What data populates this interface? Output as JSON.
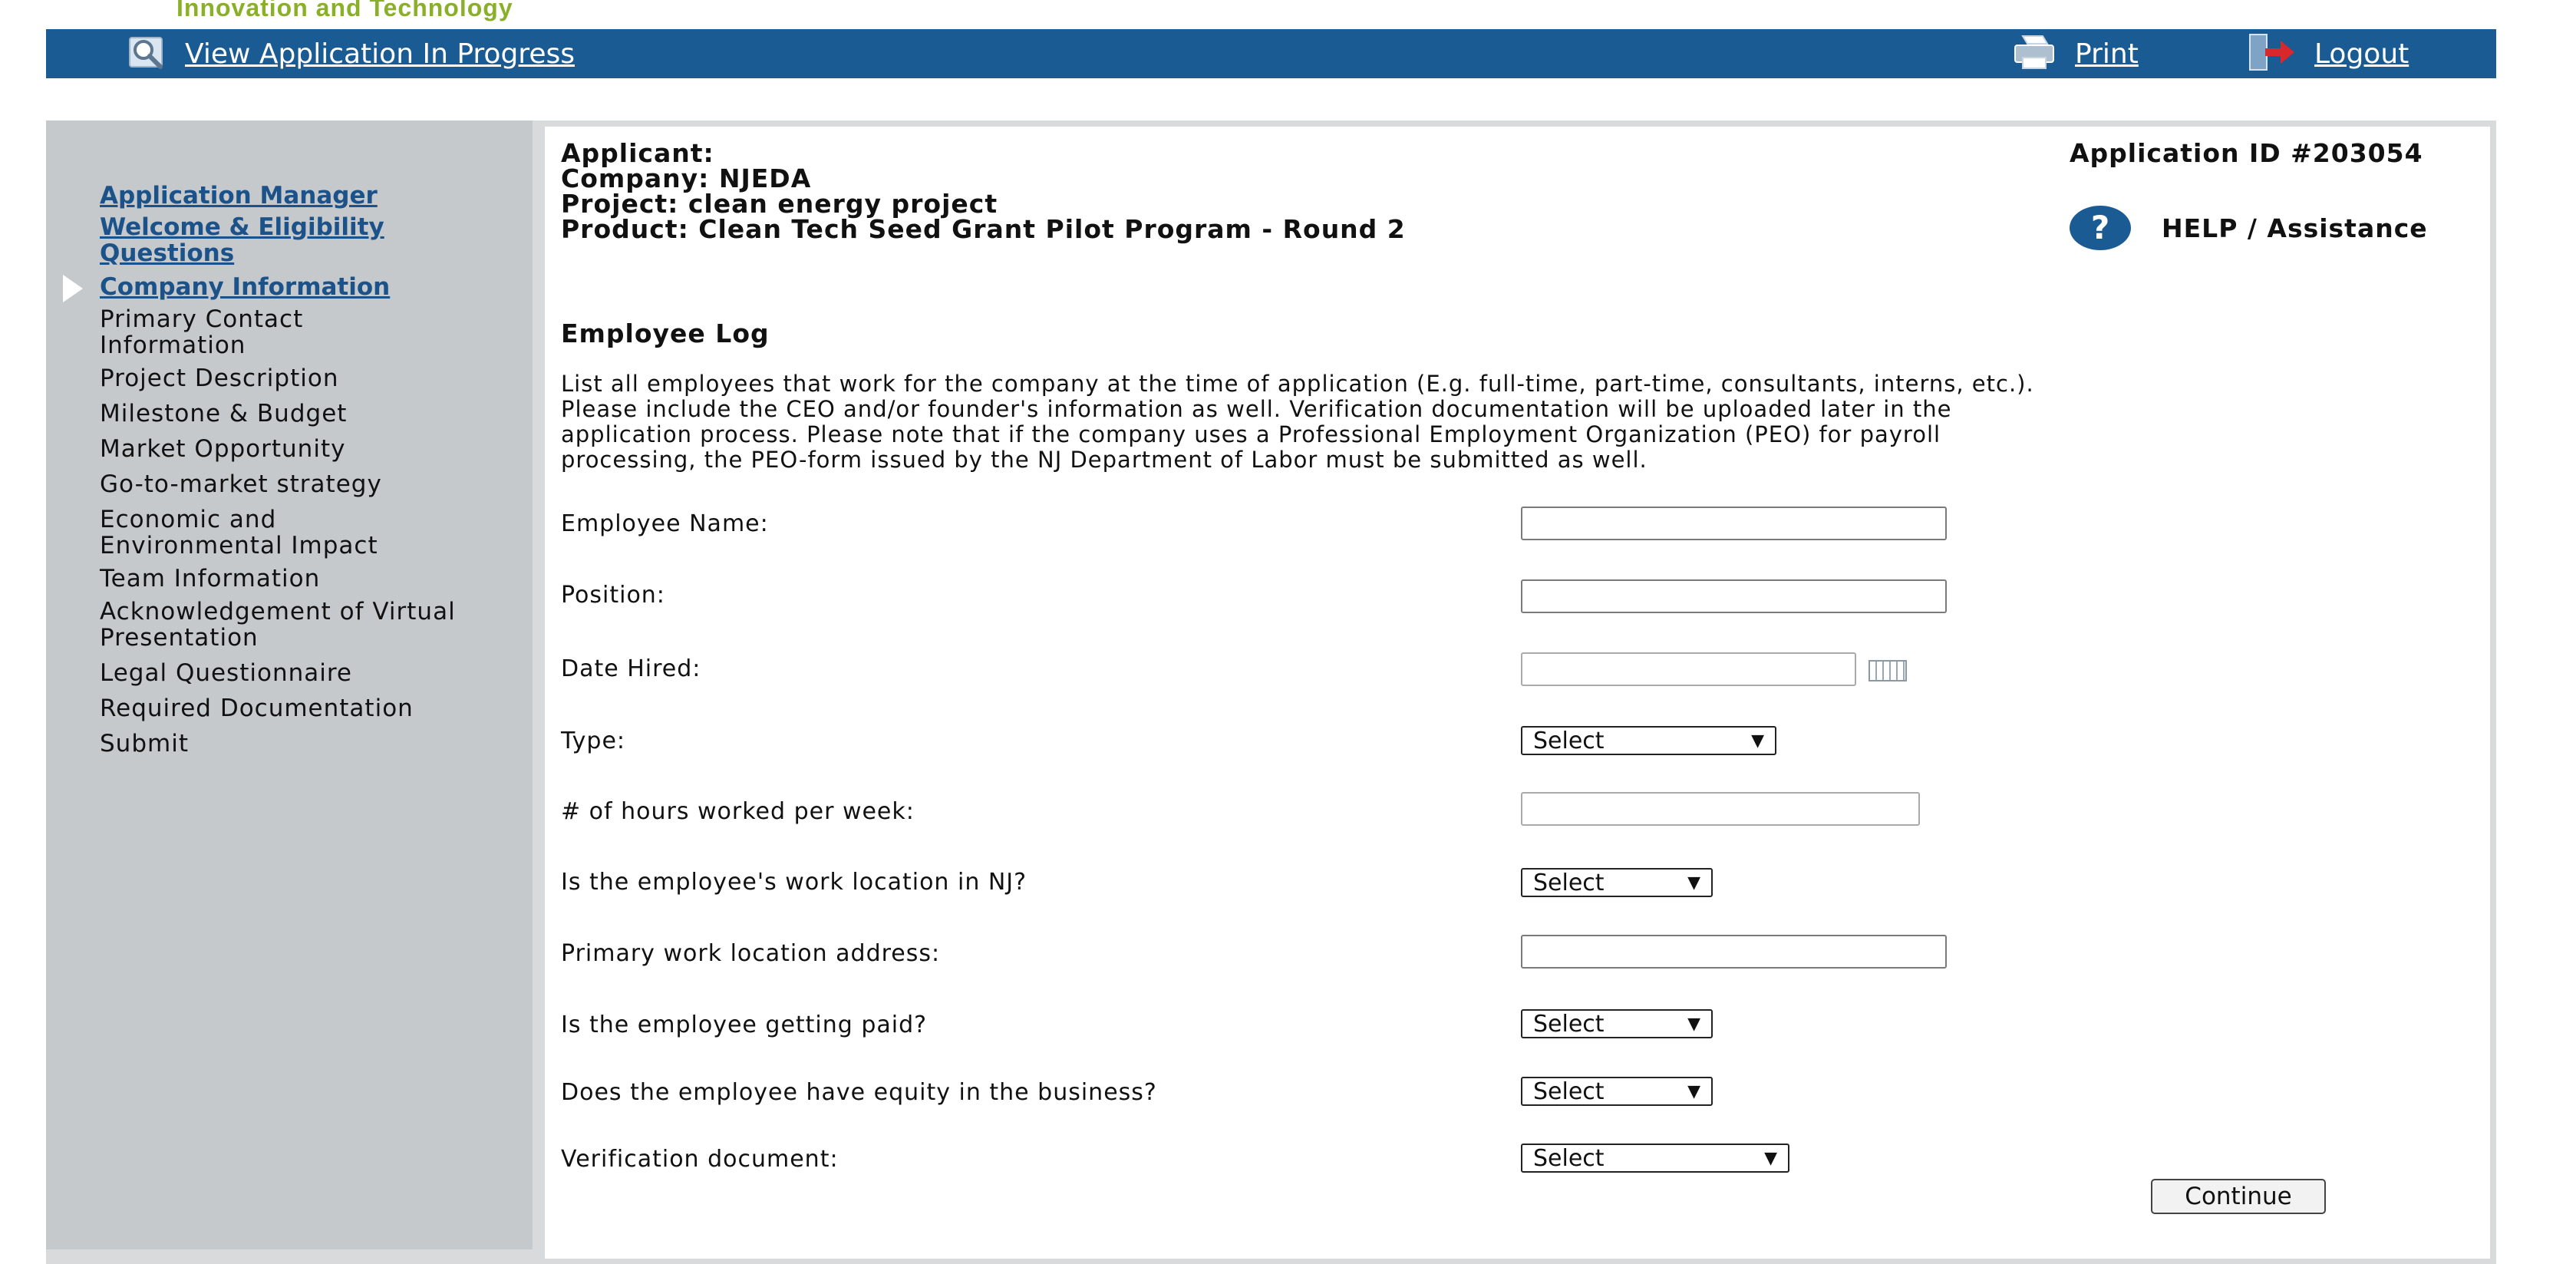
{
  "header": {
    "tagline": "Innovation and Technology",
    "view_application_label": "View Application In Progress",
    "print_label": "Print",
    "logout_label": "Logout"
  },
  "sidebar": {
    "items": [
      {
        "label": "Application Manager",
        "link": true
      },
      {
        "label": "Welcome & Eligibility Questions",
        "link": true
      },
      {
        "label": "Company Information",
        "link": true,
        "current": true
      },
      {
        "label": "Primary Contact Information",
        "link": false
      },
      {
        "label": "Project Description",
        "link": false
      },
      {
        "label": "Milestone & Budget",
        "link": false
      },
      {
        "label": "Market Opportunity",
        "link": false
      },
      {
        "label": "Go-to-market strategy",
        "link": false
      },
      {
        "label": "Economic and Environmental Impact",
        "link": false
      },
      {
        "label": "Team Information",
        "link": false
      },
      {
        "label": "Acknowledgement of Virtual Presentation",
        "link": false
      },
      {
        "label": "Legal Questionnaire",
        "link": false
      },
      {
        "label": "Required Documentation",
        "link": false
      },
      {
        "label": "Submit",
        "link": false
      }
    ]
  },
  "info": {
    "applicant": "Applicant:",
    "company": "Company: NJEDA",
    "project": "Project: clean energy project",
    "product": "Product: Clean Tech Seed Grant Pilot Program - Round 2",
    "application_id": "Application ID #203054",
    "help_label": "HELP / Assistance"
  },
  "form": {
    "title": "Employee Log",
    "instructions": [
      "List all employees that work for the company at the time of application (E.g. full-time, part-time, consultants, interns, etc.).",
      "Please include the CEO and/or founder's information as well. Verification documentation will be uploaded later in the",
      "application process. Please note that if the company uses a Professional Employment Organization (PEO) for payroll",
      "processing, the PEO-form issued by the NJ Department of Labor must be submitted as well."
    ],
    "fields": {
      "employee_name": {
        "label": "Employee Name:",
        "value": ""
      },
      "position": {
        "label": "Position:",
        "value": ""
      },
      "date_hired": {
        "label": "Date Hired:",
        "value": ""
      },
      "type": {
        "label": "Type:",
        "value": "Select"
      },
      "hours": {
        "label": "# of hours worked per week:",
        "value": ""
      },
      "nj_location": {
        "label": "Is the employee's work location in NJ?",
        "value": "Select"
      },
      "address": {
        "label": "Primary work location address:",
        "value": ""
      },
      "paid": {
        "label": "Is the employee getting paid?",
        "value": "Select"
      },
      "equity": {
        "label": "Does the employee have equity in the business?",
        "value": "Select"
      },
      "verification": {
        "label": "Verification document:",
        "value": "Select"
      }
    },
    "continue_label": "Continue"
  },
  "colors": {
    "topbar": "#1b5b93",
    "sidebar": "#c5c9cc",
    "link": "#1a5289",
    "help_icon": "#1b5b93"
  }
}
